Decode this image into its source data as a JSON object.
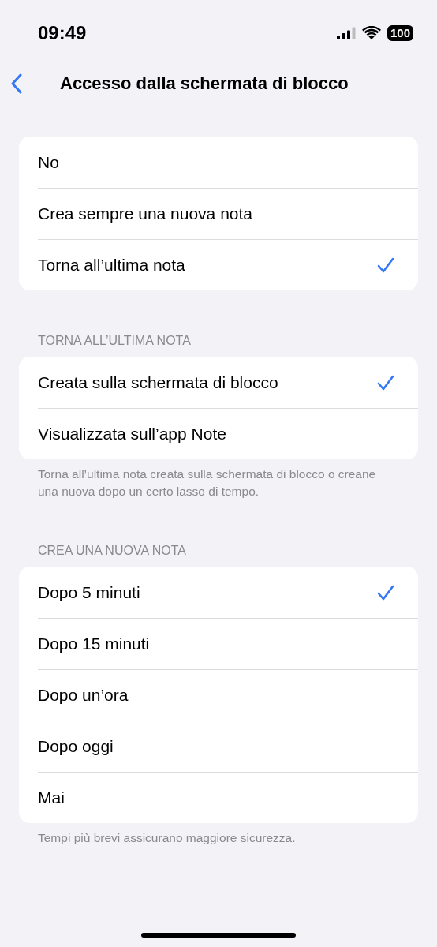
{
  "status_bar": {
    "time": "09:49",
    "battery": "100"
  },
  "nav": {
    "title": "Accesso dalla schermata di blocco"
  },
  "sections": [
    {
      "options": [
        {
          "label": "No",
          "selected": false
        },
        {
          "label": "Crea sempre una nuova nota",
          "selected": false
        },
        {
          "label": "Torna all’ultima nota",
          "selected": true
        }
      ]
    },
    {
      "header": "TORNA ALL’ULTIMA NOTA",
      "options": [
        {
          "label": "Creata sulla schermata di blocco",
          "selected": true
        },
        {
          "label": "Visualizzata sull’app Note",
          "selected": false
        }
      ],
      "footer": "Torna all’ultima nota creata sulla schermata di blocco o creane una nuova dopo un certo lasso di tempo."
    },
    {
      "header": "CREA UNA NUOVA NOTA",
      "options": [
        {
          "label": "Dopo 5 minuti",
          "selected": true
        },
        {
          "label": "Dopo 15 minuti",
          "selected": false
        },
        {
          "label": "Dopo un’ora",
          "selected": false
        },
        {
          "label": "Dopo oggi",
          "selected": false
        },
        {
          "label": "Mai",
          "selected": false
        }
      ],
      "footer": "Tempi più brevi assicurano maggiore sicurezza."
    }
  ]
}
